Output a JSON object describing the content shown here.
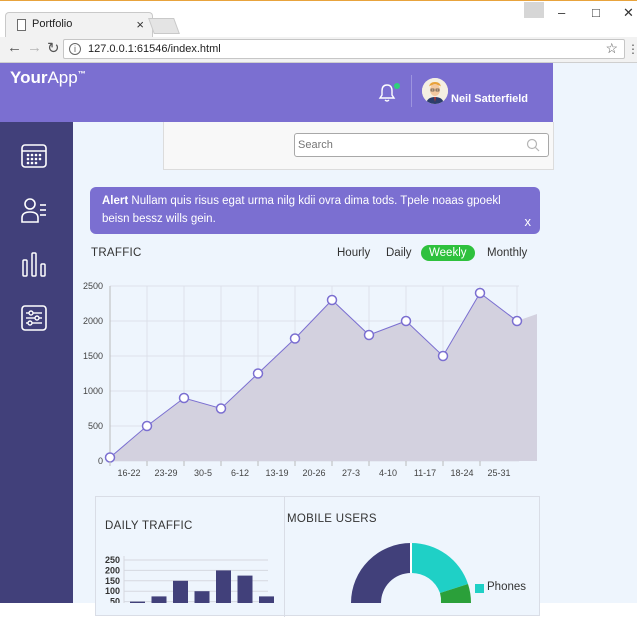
{
  "browser": {
    "tab_title": "Portfolio",
    "tab_close": "×",
    "url": "127.0.0.1:61546/index.html",
    "win_minimize": "–",
    "win_maximize": "□",
    "win_close": "✕"
  },
  "app": {
    "logo_your": "Your",
    "logo_app": "App",
    "logo_tm": "™",
    "user_name": "Neil Satterfield",
    "notification_active": true,
    "search_placeholder": "Search",
    "alert": {
      "label": "Alert",
      "text": " Nullam quis risus egat urma nilg kdii ovra dima tods. Tpele noaas gpoekl beisn bessz wills gein.",
      "close": "x"
    },
    "sidebar_icons": [
      "calendar-icon",
      "contacts-icon",
      "bar-chart-icon",
      "settings-sliders-icon"
    ],
    "traffic": {
      "title": "TRAFFIC",
      "ranges": [
        "Hourly",
        "Daily",
        "Weekly",
        "Monthly"
      ],
      "active_range": "Weekly"
    },
    "daily_traffic": {
      "title": "DAILY TRAFFIC"
    },
    "mobile_users": {
      "title": "MOBILE USERS",
      "legend": [
        "Phones"
      ]
    }
  },
  "colors": {
    "header": "#7b6fd1",
    "sidebar": "#41407a",
    "accent_green": "#2ec13d",
    "area_fill": "#d3d1df",
    "line": "#7b6fd1",
    "phones": "#1fd0c6",
    "donut_dark": "#41407a",
    "donut_green": "#2ba03a"
  },
  "chart_data": [
    {
      "type": "area",
      "title": "TRAFFIC",
      "categories": [
        "16-22",
        "23-29",
        "30-5",
        "6-12",
        "13-19",
        "20-26",
        "27-3",
        "4-10",
        "11-17",
        "18-24",
        "25-31"
      ],
      "series": [
        {
          "values": [
            50,
            500,
            900,
            750,
            1250,
            1750,
            2300,
            1800,
            2000,
            1500,
            2400,
            2000
          ]
        }
      ],
      "ylim": [
        0,
        2500
      ],
      "yticks": [
        0,
        500,
        1000,
        1500,
        2000,
        2500
      ],
      "grid": true
    },
    {
      "type": "bar",
      "title": "DAILY TRAFFIC",
      "values": [
        50,
        75,
        150,
        100,
        200,
        175,
        75
      ],
      "yticks_visible": [
        250,
        200,
        150,
        100,
        50
      ],
      "grid": true
    },
    {
      "type": "pie",
      "title": "MOBILE USERS",
      "legend": [
        "Phones"
      ]
    }
  ]
}
